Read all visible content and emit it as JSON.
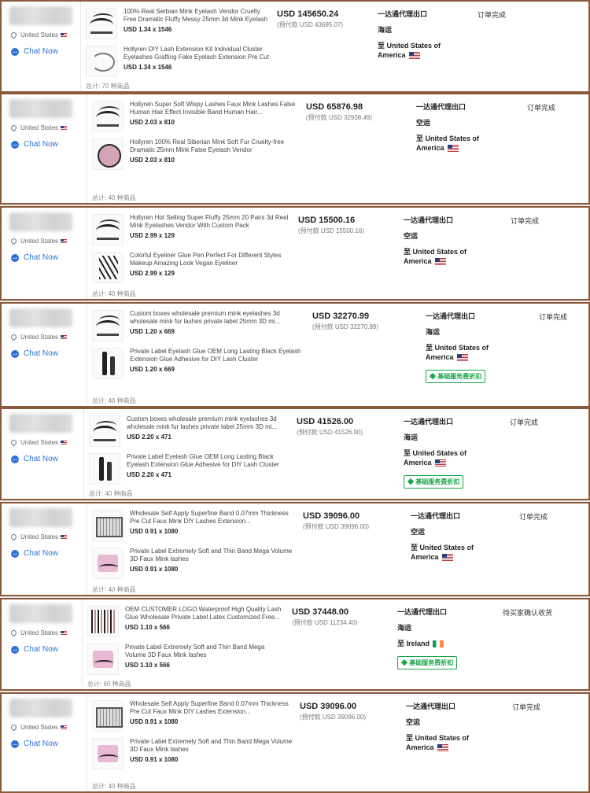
{
  "orders": [
    {
      "location": "United States",
      "chat_label": "Chat Now",
      "items": [
        {
          "title": "100% Real Serbian Mink Eyelash Vendor Cruelty Free Dramatic Fluffy Messy 25mm 3d Mink Eyelash with...",
          "qty": "USD 1.34 x 1546",
          "thumb_icon": "lash-icon"
        },
        {
          "title": "Hollyren DIY Lash Extension Kit Individual Cluster Eyelashes Grafting Fake Eyelash Extension Pre Cut Di...",
          "qty": "USD 1.34 x 1546",
          "thumb_icon": "lash-cluster-icon"
        }
      ],
      "total": "总计: 70 种商品",
      "price": "USD 145650.24",
      "deposit": "(预付款 USD 43695.07)",
      "ship_method": "一达通代理出口",
      "transport": "海运",
      "dest_line1": "至 United States of",
      "dest_line2": "America",
      "dest_flag": "us",
      "badge": "",
      "status": "订单完成"
    },
    {
      "location": "United States",
      "chat_label": "Chat Now",
      "items": [
        {
          "title": "Hollyren Super Soft Wispy Lashes Faux Mink Lashes False Human Hair Effect Invisible Band Human Hair...",
          "qty": "USD 2.03 x 810",
          "thumb_icon": "lash-icon"
        },
        {
          "title": "Hollyren 100% Real Siberian Mink Soft Fur Cruelty-free Dramatic 25mm Mink False Eyelash Vendor",
          "qty": "USD 2.03 x 810",
          "thumb_icon": "lash-round-icon"
        }
      ],
      "total": "总计: 40 种商品",
      "price": "USD 65876.98",
      "deposit": "(预付款 USD 32938.49)",
      "ship_method": "一达通代理出口",
      "transport": "空运",
      "dest_line1": "至 United States of",
      "dest_line2": "America",
      "dest_flag": "us",
      "badge": "",
      "status": "订单完成"
    },
    {
      "location": "United States",
      "chat_label": "Chat Now",
      "items": [
        {
          "title": "Hollyren Hot Selling Super Fluffy 25mm 20 Pairs 3d Real Mink Eyelashes Vendor With Custom Pack",
          "qty": "USD 2.99 x 129",
          "thumb_icon": "lash-icon"
        },
        {
          "title": "Colorful Eyeliner Glue Pen Perfect For Different Styles Makeup Amazing Look Vegan Eyeliner",
          "qty": "USD 2.99 x 129",
          "thumb_icon": "eyeliner-pens-icon"
        }
      ],
      "total": "总计: 40 种商品",
      "price": "USD 15500.16",
      "deposit": "(预付款 USD 15500.16)",
      "ship_method": "一达通代理出口",
      "transport": "空运",
      "dest_line1": "至 United States of",
      "dest_line2": "America",
      "dest_flag": "us",
      "badge": "",
      "status": "订单完成"
    },
    {
      "location": "United States",
      "chat_label": "Chat Now",
      "items": [
        {
          "title": "Custom boxes wholesale premium mink eyelashes 3d wholesale mink fur lashes private label 25mm 3D mi...",
          "qty": "USD 1.20 x 669",
          "thumb_icon": "lash-icon"
        },
        {
          "title": "Private Label Eyelash Glue OEM Long Lasting Black Eyelash Extension Glue Adhesive for DIY Lash Cluster",
          "qty": "USD 1.20 x 669",
          "thumb_icon": "glue-icon"
        }
      ],
      "total": "总计: 40 种商品",
      "price": "USD 32270.99",
      "deposit": "(预付款 USD 32270.99)",
      "ship_method": "一达通代理出口",
      "transport": "海运",
      "dest_line1": "至 United States of",
      "dest_line2": "America",
      "dest_flag": "us",
      "badge": "基础服务费折扣",
      "status": "订单完成"
    },
    {
      "location": "United States",
      "chat_label": "Chat Now",
      "items": [
        {
          "title": "Custom boxes wholesale premium mink eyelashes 3d wholesale mink fur lashes private label 25mm 3D mi...",
          "qty": "USD 2.20 x 471",
          "thumb_icon": "lash-icon"
        },
        {
          "title": "Private Label Eyelash Glue OEM Long Lasting Black Eyelash Extension Glue Adhesive for DIY Lash Cluster",
          "qty": "USD 2.20 x 471",
          "thumb_icon": "glue-icon"
        }
      ],
      "total": "总计: 40 种商品",
      "price": "USD 41526.00",
      "deposit": "(预付款 USD 41526.00)",
      "ship_method": "一达通代理出口",
      "transport": "海运",
      "dest_line1": "至 United States of",
      "dest_line2": "America",
      "dest_flag": "us",
      "badge": "基础服务费折扣",
      "status": "订单完成"
    },
    {
      "location": "United States",
      "chat_label": "Chat Now",
      "items": [
        {
          "title": "Wholesale Self Apply Superfine Band 0.07mm Thickness Pre Cut Faux Mink DIY Lashes Extension...",
          "qty": "USD 0.91 x 1080",
          "thumb_icon": "lash-box-icon"
        },
        {
          "title": "Private Label Extremely Soft and Thin Band Mega Volume 3D Faux Mink lashes",
          "qty": "USD 0.91 x 1080",
          "thumb_icon": "lash-pink-icon"
        }
      ],
      "total": "总计: 40 种商品",
      "price": "USD 39096.00",
      "deposit": "(预付款 USD 39096.00)",
      "ship_method": "一达通代理出口",
      "transport": "空运",
      "dest_line1": "至 United States of",
      "dest_line2": "America",
      "dest_flag": "us",
      "badge": "",
      "status": "订单完成"
    },
    {
      "location": "United States",
      "chat_label": "Chat Now",
      "items": [
        {
          "title": "OEM CUSTOMER LOGO Waterproof High Quality Lash Glue Wholesale Private Label Latex Customized Free...",
          "qty": "USD 1.10 x 566",
          "thumb_icon": "glue-set-icon"
        },
        {
          "title": "Private Label Extremely Soft and Thin Band Mega Volume 3D Faux Mink lashes",
          "qty": "USD 1.10 x 566",
          "thumb_icon": "lash-pink-icon"
        }
      ],
      "total": "总计: 60 种商品",
      "price": "USD 37448.00",
      "deposit": "(预付款 USD 11234.40)",
      "ship_method": "一达通代理出口",
      "transport": "海运",
      "dest_line1": "至 Ireland",
      "dest_line2": "",
      "dest_flag": "ie",
      "badge": "基础服务费折扣",
      "status": "待买家确认收货"
    },
    {
      "location": "United States",
      "chat_label": "Chat Now",
      "items": [
        {
          "title": "Wholesale Self Apply Superfine Band 0.07mm Thickness Pre Cut Faux Mink DIY Lashes Extension...",
          "qty": "USD 0.91 x 1080",
          "thumb_icon": "lash-box-icon"
        },
        {
          "title": "Private Label Extremely Soft and Thin Band Mega Volume 3D Faux Mink lashes",
          "qty": "USD 0.91 x 1080",
          "thumb_icon": "lash-pink-icon"
        }
      ],
      "total": "总计: 40 种商品",
      "price": "USD 39096.00",
      "deposit": "(预付款 USD 39096.00)",
      "ship_method": "一达通代理出口",
      "transport": "空运",
      "dest_line1": "至 United States of",
      "dest_line2": "America",
      "dest_flag": "us",
      "badge": "",
      "status": "订单完成"
    }
  ]
}
